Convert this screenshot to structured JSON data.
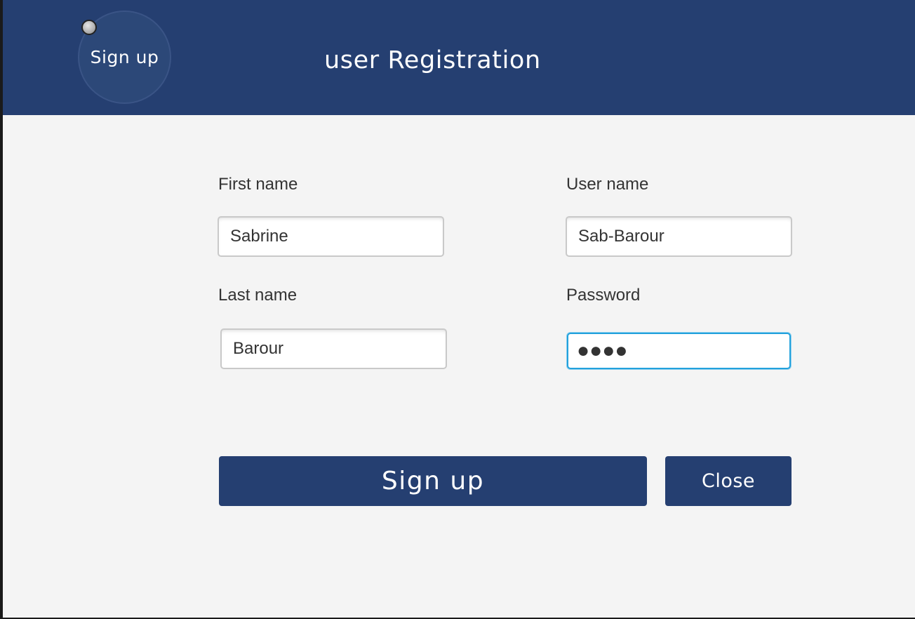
{
  "header": {
    "badge_label": "Sign up",
    "title": "user Registration"
  },
  "form": {
    "first_name": {
      "label": "First name",
      "value": "Sabrine"
    },
    "last_name": {
      "label": "Last name",
      "value": "Barour"
    },
    "user_name": {
      "label": "User name",
      "value": "Sab-Barour"
    },
    "password": {
      "label": "Password",
      "value": "●●●●"
    }
  },
  "actions": {
    "signup_label": "Sign up",
    "close_label": "Close"
  },
  "colors": {
    "header_bg": "#253f71",
    "content_bg": "#f4f4f4",
    "focus_ring": "#22a1dc"
  }
}
